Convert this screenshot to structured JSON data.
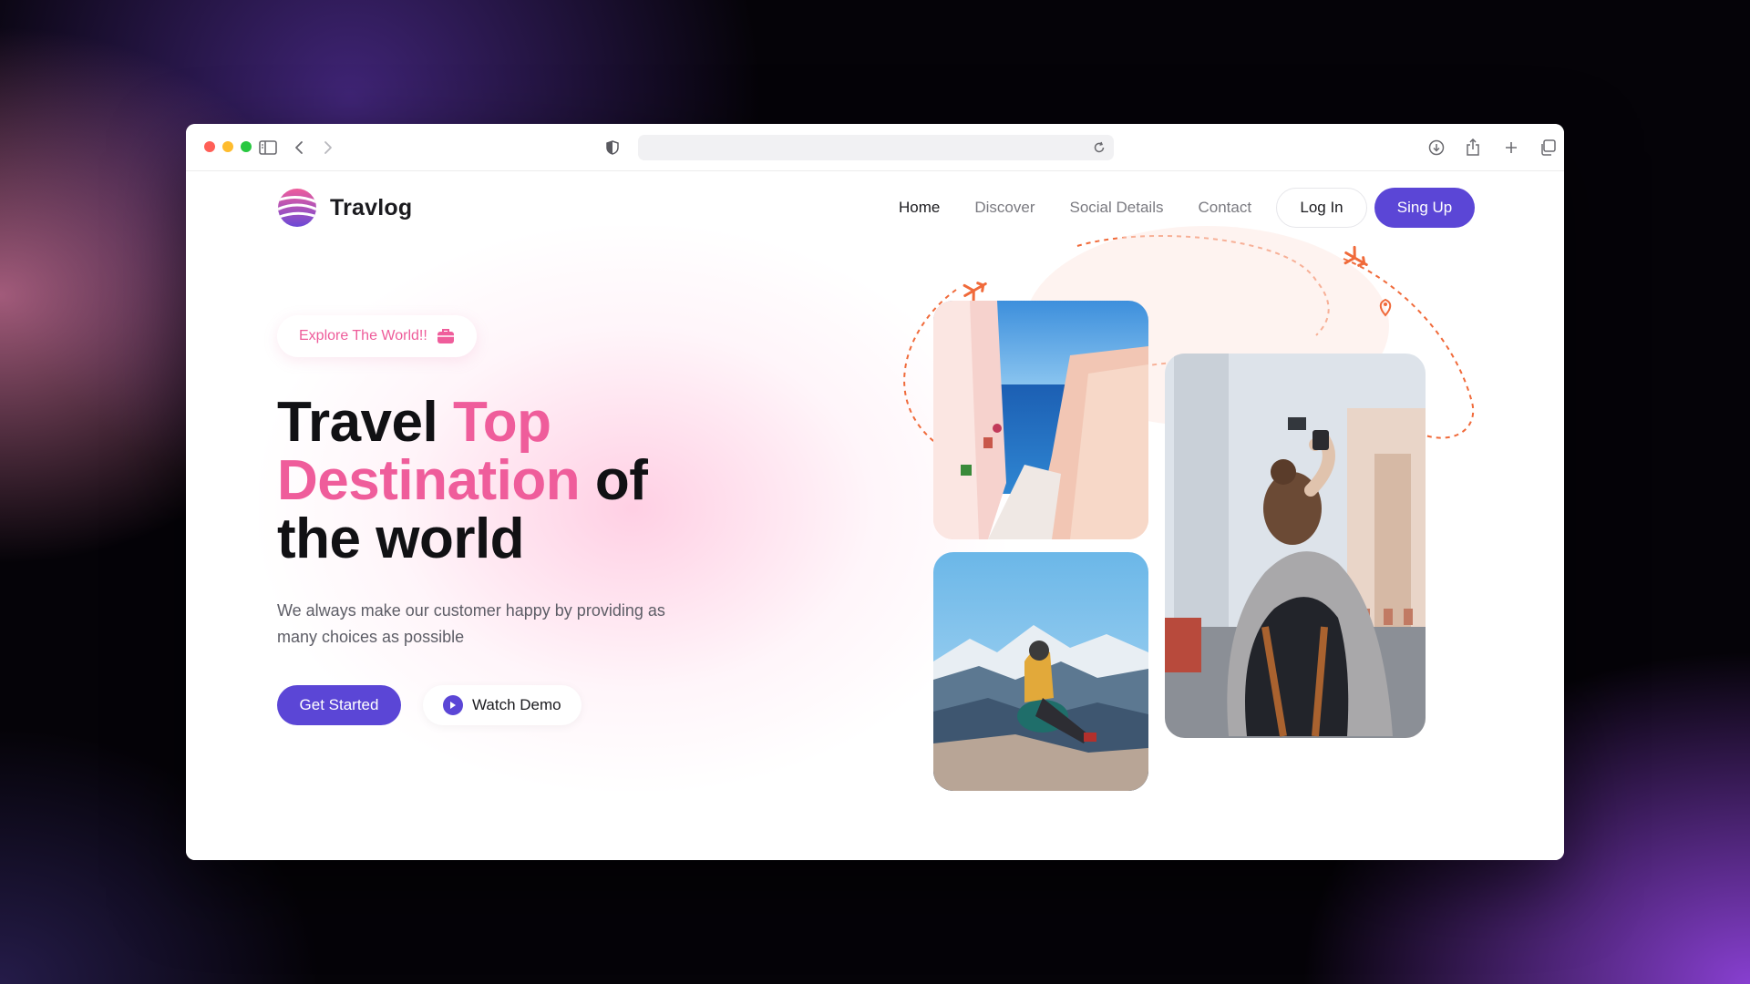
{
  "brand": {
    "name": "Travlog"
  },
  "nav": {
    "links": [
      "Home",
      "Discover",
      "Social Details",
      "Contact"
    ],
    "login": "Log In",
    "signup": "Sing Up"
  },
  "hero": {
    "badge": "Explore The World!!",
    "title_parts": [
      "Travel",
      "Top",
      "Destination",
      "of",
      "the world"
    ],
    "subtitle": "We always make our customer happy by providing as many choices as possible",
    "cta_primary": "Get Started",
    "cta_secondary": "Watch Demo"
  },
  "colors": {
    "accent": "#5b46d6",
    "pink": "#ef5d9b",
    "route": "#f06a3a"
  },
  "icons": [
    "sidebar-icon",
    "back-icon",
    "forward-icon",
    "shield-icon",
    "reload-icon",
    "download-icon",
    "share-icon",
    "plus-icon",
    "tabs-icon",
    "suitcase-icon",
    "play-icon",
    "airplane-icon",
    "location-pin-icon"
  ]
}
